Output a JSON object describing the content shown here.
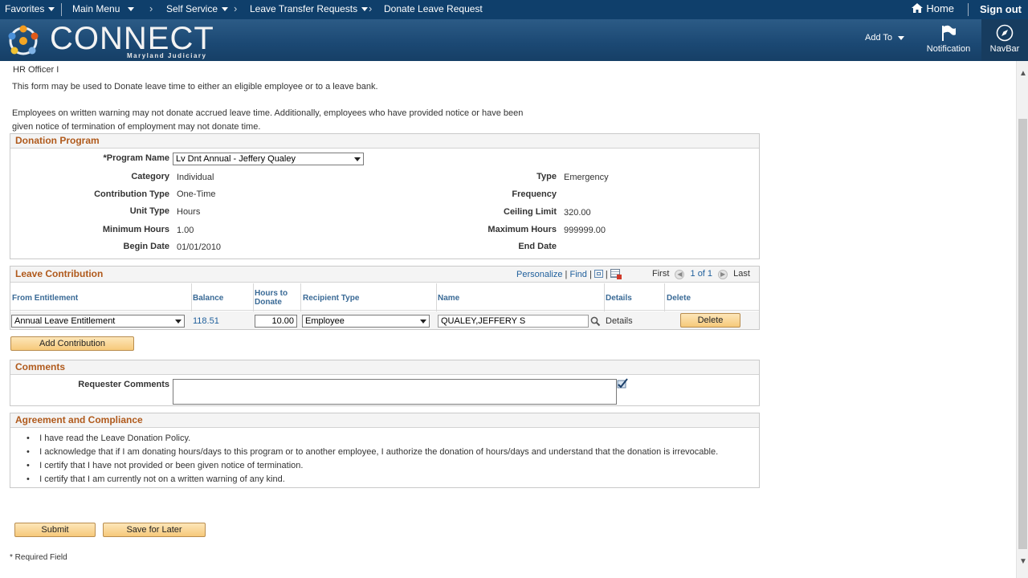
{
  "topbar": {
    "favorites": "Favorites",
    "main_menu": "Main Menu",
    "self_service": "Self Service",
    "leave_transfer": "Leave Transfer Requests",
    "current": "Donate Leave Request",
    "home": "Home",
    "sign_out": "Sign out"
  },
  "banner": {
    "logo_word": "CONNECT",
    "logo_sub": "Maryland Judiciary",
    "add_to": "Add To",
    "notification": "Notification",
    "navbar": "NavBar"
  },
  "page": {
    "role": "HR Officer I",
    "intro": "This form may be used to Donate leave time to either an eligible employee or to a leave bank.",
    "warning_line1": "Employees on written warning may not donate accrued leave time. Additionally, employees who have provided notice or have been",
    "warning_line2": "given notice of termination of employment may not donate time."
  },
  "donation": {
    "title": "Donation Program",
    "program_name_label": "*Program Name",
    "program_name_value": "Lv Dnt Annual - Jeffery Qualey",
    "category_label": "Category",
    "category_value": "Individual",
    "type_label": "Type",
    "type_value": "Emergency",
    "contribution_type_label": "Contribution Type",
    "contribution_type_value": "One-Time",
    "frequency_label": "Frequency",
    "unit_type_label": "Unit Type",
    "unit_type_value": "Hours",
    "ceiling_limit_label": "Ceiling Limit",
    "ceiling_limit_value": "320.00",
    "minimum_hours_label": "Minimum Hours",
    "minimum_hours_value": "1.00",
    "maximum_hours_label": "Maximum Hours",
    "maximum_hours_value": "999999.00",
    "begin_date_label": "Begin Date",
    "begin_date_value": "01/01/2010",
    "end_date_label": "End Date"
  },
  "contribution": {
    "title": "Leave Contribution",
    "personalize": "Personalize",
    "find": "Find",
    "first": "First",
    "page_count": "1 of 1",
    "last": "Last",
    "headers": {
      "from_entitlement": "From Entitlement",
      "balance": "Balance",
      "hours_line1": "Hours to",
      "hours_line2": "Donate",
      "recipient_type": "Recipient Type",
      "name": "Name",
      "details": "Details",
      "delete": "Delete"
    },
    "row": {
      "from_entitlement": "Annual Leave Entitlement",
      "balance": "118.51",
      "hours": "10.00",
      "recipient_type": "Employee",
      "name": "QUALEY,JEFFERY S",
      "details": "Details",
      "delete": "Delete"
    },
    "add_button": "Add Contribution"
  },
  "comments": {
    "title": "Comments",
    "requester_label": "Requester Comments",
    "requester_value": ""
  },
  "agreement": {
    "title": "Agreement and Compliance",
    "items": [
      "I have read the Leave Donation Policy.",
      "I acknowledge that if I am donating hours/days to this program or to another employee, I authorize the donation of hours/days and understand that the donation is irrevocable.",
      "I certify that I have not provided or been given notice of termination.",
      "I certify that I am currently not on a written warning of any kind."
    ]
  },
  "actions": {
    "submit": "Submit",
    "save_for_later": "Save for Later",
    "required_note": "* Required Field"
  }
}
